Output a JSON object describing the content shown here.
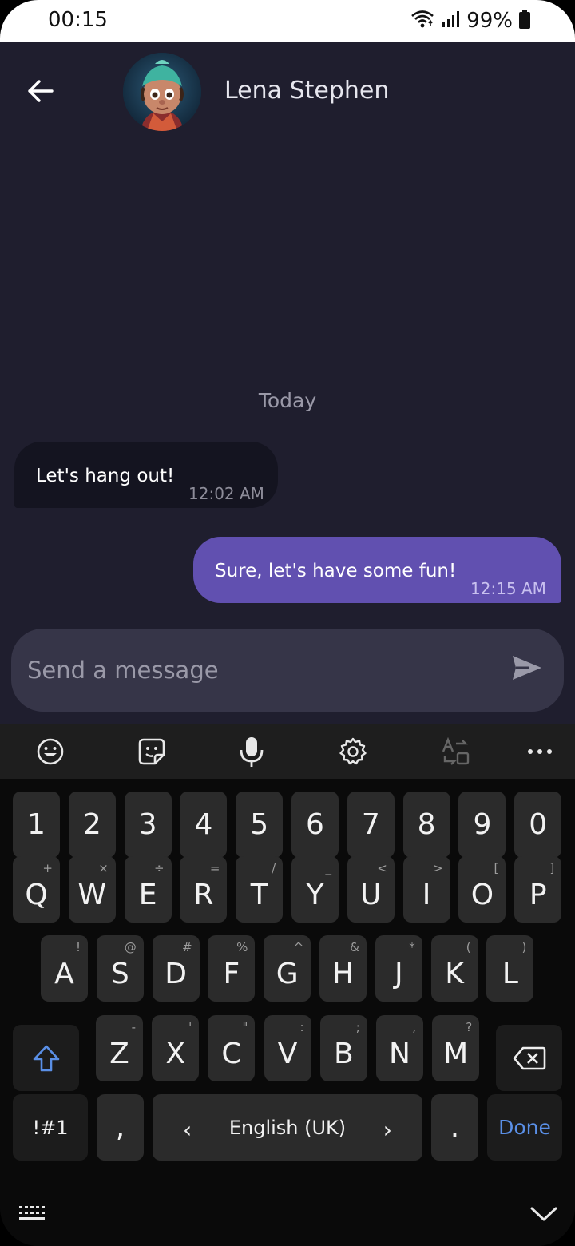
{
  "status": {
    "time": "00:15",
    "battery": "99%"
  },
  "header": {
    "contact_name": "Lena Stephen"
  },
  "chat": {
    "date_separator": "Today",
    "messages": [
      {
        "text": "Let's hang out!",
        "time": "12:02 AM",
        "direction": "incoming"
      },
      {
        "text": "Sure, let's have some fun!",
        "time": "12:15 AM",
        "direction": "outgoing"
      }
    ]
  },
  "composer": {
    "placeholder": "Send a message",
    "value": ""
  },
  "keyboard": {
    "toolbar_icons": [
      "emoji-icon",
      "sticker-icon",
      "microphone-icon",
      "settings-icon",
      "translate-icon",
      "more-icon"
    ],
    "number_row": [
      "1",
      "2",
      "3",
      "4",
      "5",
      "6",
      "7",
      "8",
      "9",
      "0"
    ],
    "row1": {
      "keys": [
        "Q",
        "W",
        "E",
        "R",
        "T",
        "Y",
        "U",
        "I",
        "O",
        "P"
      ],
      "hints": [
        "+",
        "×",
        "÷",
        "=",
        "/",
        "_",
        "<",
        ">",
        "[",
        "]"
      ]
    },
    "row2": {
      "keys": [
        "A",
        "S",
        "D",
        "F",
        "G",
        "H",
        "J",
        "K",
        "L"
      ],
      "hints": [
        "!",
        "@",
        "#",
        "%",
        "^",
        "&",
        "*",
        "(",
        ")"
      ]
    },
    "row3": {
      "keys": [
        "Z",
        "X",
        "C",
        "V",
        "B",
        "N",
        "M"
      ],
      "hints": [
        "-",
        "'",
        "\"",
        ":",
        ";",
        ",",
        "?"
      ]
    },
    "symbols_label": "!#1",
    "comma": ",",
    "space_label": "English (UK)",
    "period": ".",
    "done_label": "Done"
  },
  "colors": {
    "chat_bg": "#1f1e2e",
    "outgoing_bubble": "#6150b0",
    "incoming_bubble": "#141420",
    "accent_blue": "#5a8fe6"
  }
}
